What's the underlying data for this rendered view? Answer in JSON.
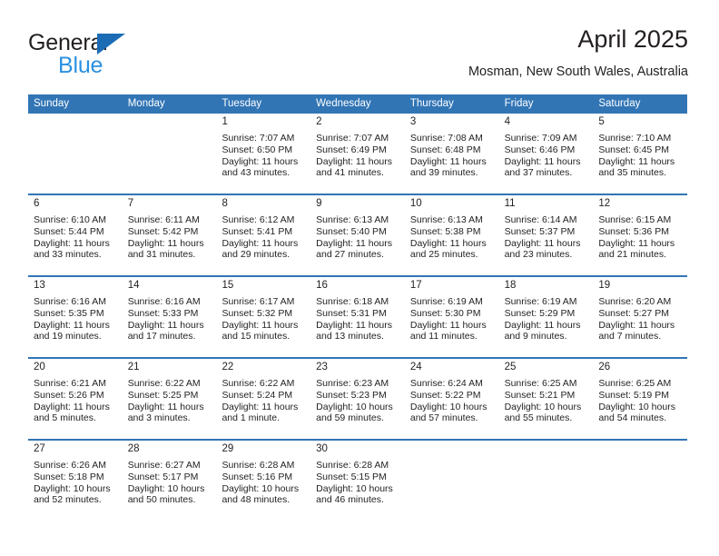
{
  "logo": {
    "word_general": "General",
    "word_blue": "Blue",
    "triangle_color": "#1b6cb5",
    "blue_text_color": "#2b90e0"
  },
  "header": {
    "title": "April 2025",
    "subtitle": "Mosman, New South Wales, Australia"
  },
  "theme": {
    "header_blue": "#3175b5",
    "daynum_band": "#f0f0f0",
    "text": "#231f20"
  },
  "calendar": {
    "weekdays": [
      "Sunday",
      "Monday",
      "Tuesday",
      "Wednesday",
      "Thursday",
      "Friday",
      "Saturday"
    ],
    "weeks": [
      [
        {
          "day": "",
          "empty": true,
          "sunrise": "",
          "sunset": "",
          "daylight1": "",
          "daylight2": ""
        },
        {
          "day": "",
          "empty": true,
          "sunrise": "",
          "sunset": "",
          "daylight1": "",
          "daylight2": ""
        },
        {
          "day": "1",
          "sunrise": "Sunrise: 7:07 AM",
          "sunset": "Sunset: 6:50 PM",
          "daylight1": "Daylight: 11 hours",
          "daylight2": "and 43 minutes."
        },
        {
          "day": "2",
          "sunrise": "Sunrise: 7:07 AM",
          "sunset": "Sunset: 6:49 PM",
          "daylight1": "Daylight: 11 hours",
          "daylight2": "and 41 minutes."
        },
        {
          "day": "3",
          "sunrise": "Sunrise: 7:08 AM",
          "sunset": "Sunset: 6:48 PM",
          "daylight1": "Daylight: 11 hours",
          "daylight2": "and 39 minutes."
        },
        {
          "day": "4",
          "sunrise": "Sunrise: 7:09 AM",
          "sunset": "Sunset: 6:46 PM",
          "daylight1": "Daylight: 11 hours",
          "daylight2": "and 37 minutes."
        },
        {
          "day": "5",
          "sunrise": "Sunrise: 7:10 AM",
          "sunset": "Sunset: 6:45 PM",
          "daylight1": "Daylight: 11 hours",
          "daylight2": "and 35 minutes."
        }
      ],
      [
        {
          "day": "6",
          "sunrise": "Sunrise: 6:10 AM",
          "sunset": "Sunset: 5:44 PM",
          "daylight1": "Daylight: 11 hours",
          "daylight2": "and 33 minutes."
        },
        {
          "day": "7",
          "sunrise": "Sunrise: 6:11 AM",
          "sunset": "Sunset: 5:42 PM",
          "daylight1": "Daylight: 11 hours",
          "daylight2": "and 31 minutes."
        },
        {
          "day": "8",
          "sunrise": "Sunrise: 6:12 AM",
          "sunset": "Sunset: 5:41 PM",
          "daylight1": "Daylight: 11 hours",
          "daylight2": "and 29 minutes."
        },
        {
          "day": "9",
          "sunrise": "Sunrise: 6:13 AM",
          "sunset": "Sunset: 5:40 PM",
          "daylight1": "Daylight: 11 hours",
          "daylight2": "and 27 minutes."
        },
        {
          "day": "10",
          "sunrise": "Sunrise: 6:13 AM",
          "sunset": "Sunset: 5:38 PM",
          "daylight1": "Daylight: 11 hours",
          "daylight2": "and 25 minutes."
        },
        {
          "day": "11",
          "sunrise": "Sunrise: 6:14 AM",
          "sunset": "Sunset: 5:37 PM",
          "daylight1": "Daylight: 11 hours",
          "daylight2": "and 23 minutes."
        },
        {
          "day": "12",
          "sunrise": "Sunrise: 6:15 AM",
          "sunset": "Sunset: 5:36 PM",
          "daylight1": "Daylight: 11 hours",
          "daylight2": "and 21 minutes."
        }
      ],
      [
        {
          "day": "13",
          "sunrise": "Sunrise: 6:16 AM",
          "sunset": "Sunset: 5:35 PM",
          "daylight1": "Daylight: 11 hours",
          "daylight2": "and 19 minutes."
        },
        {
          "day": "14",
          "sunrise": "Sunrise: 6:16 AM",
          "sunset": "Sunset: 5:33 PM",
          "daylight1": "Daylight: 11 hours",
          "daylight2": "and 17 minutes."
        },
        {
          "day": "15",
          "sunrise": "Sunrise: 6:17 AM",
          "sunset": "Sunset: 5:32 PM",
          "daylight1": "Daylight: 11 hours",
          "daylight2": "and 15 minutes."
        },
        {
          "day": "16",
          "sunrise": "Sunrise: 6:18 AM",
          "sunset": "Sunset: 5:31 PM",
          "daylight1": "Daylight: 11 hours",
          "daylight2": "and 13 minutes."
        },
        {
          "day": "17",
          "sunrise": "Sunrise: 6:19 AM",
          "sunset": "Sunset: 5:30 PM",
          "daylight1": "Daylight: 11 hours",
          "daylight2": "and 11 minutes."
        },
        {
          "day": "18",
          "sunrise": "Sunrise: 6:19 AM",
          "sunset": "Sunset: 5:29 PM",
          "daylight1": "Daylight: 11 hours",
          "daylight2": "and 9 minutes."
        },
        {
          "day": "19",
          "sunrise": "Sunrise: 6:20 AM",
          "sunset": "Sunset: 5:27 PM",
          "daylight1": "Daylight: 11 hours",
          "daylight2": "and 7 minutes."
        }
      ],
      [
        {
          "day": "20",
          "sunrise": "Sunrise: 6:21 AM",
          "sunset": "Sunset: 5:26 PM",
          "daylight1": "Daylight: 11 hours",
          "daylight2": "and 5 minutes."
        },
        {
          "day": "21",
          "sunrise": "Sunrise: 6:22 AM",
          "sunset": "Sunset: 5:25 PM",
          "daylight1": "Daylight: 11 hours",
          "daylight2": "and 3 minutes."
        },
        {
          "day": "22",
          "sunrise": "Sunrise: 6:22 AM",
          "sunset": "Sunset: 5:24 PM",
          "daylight1": "Daylight: 11 hours",
          "daylight2": "and 1 minute."
        },
        {
          "day": "23",
          "sunrise": "Sunrise: 6:23 AM",
          "sunset": "Sunset: 5:23 PM",
          "daylight1": "Daylight: 10 hours",
          "daylight2": "and 59 minutes."
        },
        {
          "day": "24",
          "sunrise": "Sunrise: 6:24 AM",
          "sunset": "Sunset: 5:22 PM",
          "daylight1": "Daylight: 10 hours",
          "daylight2": "and 57 minutes."
        },
        {
          "day": "25",
          "sunrise": "Sunrise: 6:25 AM",
          "sunset": "Sunset: 5:21 PM",
          "daylight1": "Daylight: 10 hours",
          "daylight2": "and 55 minutes."
        },
        {
          "day": "26",
          "sunrise": "Sunrise: 6:25 AM",
          "sunset": "Sunset: 5:19 PM",
          "daylight1": "Daylight: 10 hours",
          "daylight2": "and 54 minutes."
        }
      ],
      [
        {
          "day": "27",
          "sunrise": "Sunrise: 6:26 AM",
          "sunset": "Sunset: 5:18 PM",
          "daylight1": "Daylight: 10 hours",
          "daylight2": "and 52 minutes."
        },
        {
          "day": "28",
          "sunrise": "Sunrise: 6:27 AM",
          "sunset": "Sunset: 5:17 PM",
          "daylight1": "Daylight: 10 hours",
          "daylight2": "and 50 minutes."
        },
        {
          "day": "29",
          "sunrise": "Sunrise: 6:28 AM",
          "sunset": "Sunset: 5:16 PM",
          "daylight1": "Daylight: 10 hours",
          "daylight2": "and 48 minutes."
        },
        {
          "day": "30",
          "sunrise": "Sunrise: 6:28 AM",
          "sunset": "Sunset: 5:15 PM",
          "daylight1": "Daylight: 10 hours",
          "daylight2": "and 46 minutes."
        },
        {
          "day": "",
          "empty": true,
          "sunrise": "",
          "sunset": "",
          "daylight1": "",
          "daylight2": ""
        },
        {
          "day": "",
          "empty": true,
          "sunrise": "",
          "sunset": "",
          "daylight1": "",
          "daylight2": ""
        },
        {
          "day": "",
          "empty": true,
          "sunrise": "",
          "sunset": "",
          "daylight1": "",
          "daylight2": ""
        }
      ]
    ]
  }
}
